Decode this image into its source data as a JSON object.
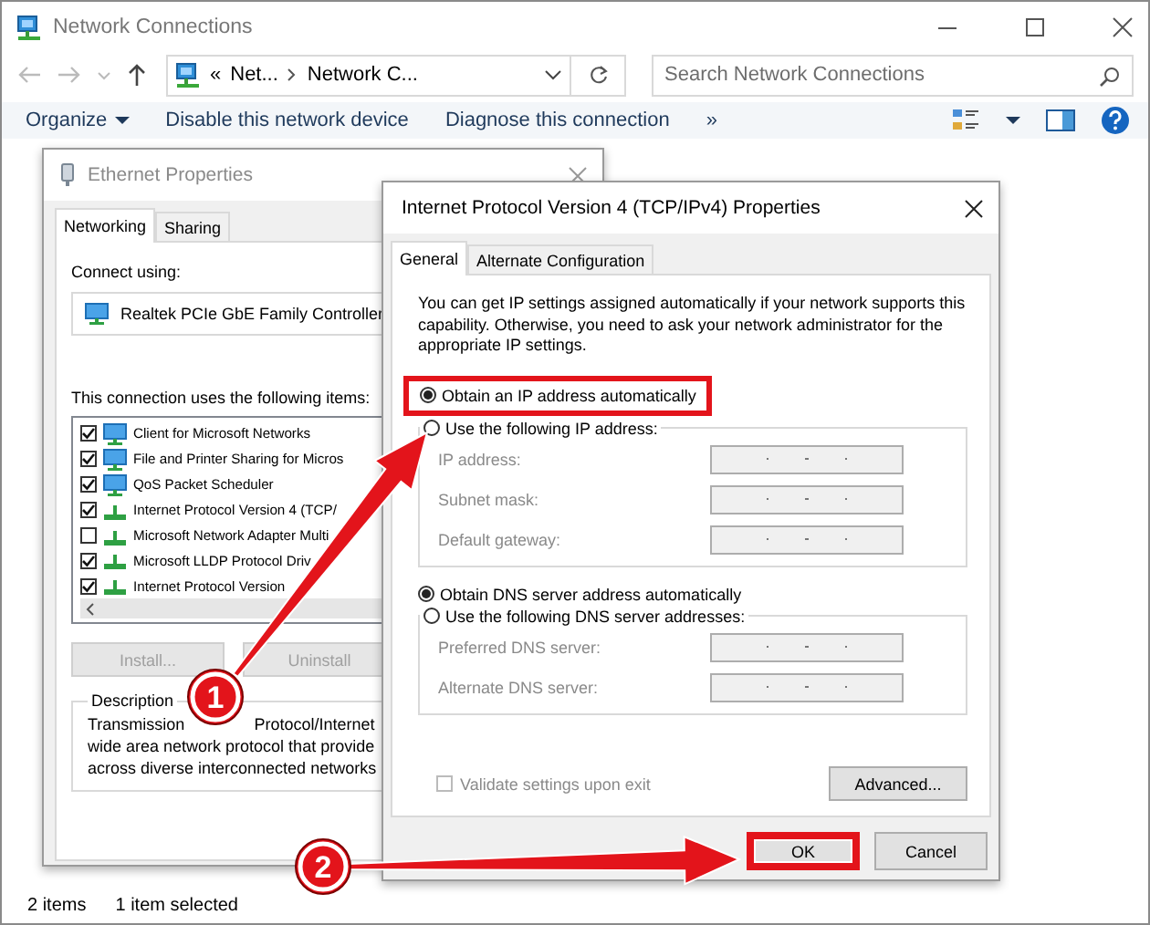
{
  "window": {
    "title": "Network Connections"
  },
  "address_bar": {
    "overflow": "«",
    "breadcrumbs": [
      "Net...",
      "Network C..."
    ]
  },
  "search": {
    "placeholder": "Search Network Connections"
  },
  "toolbar": {
    "items": [
      {
        "label": "Organize",
        "dropdown": true
      },
      {
        "label": "Disable this network device",
        "dropdown": false
      },
      {
        "label": "Diagnose this connection",
        "dropdown": false
      }
    ],
    "more": "»"
  },
  "ethernet_dialog": {
    "title": "Ethernet Properties",
    "tabs": [
      {
        "label": "Networking",
        "selected": true
      },
      {
        "label": "Sharing",
        "selected": false
      }
    ],
    "connect_using_label": "Connect using:",
    "adapter": "Realtek PCIe GbE Family Controller",
    "items_label": "This connection uses the following items:",
    "items": [
      {
        "label": "Client for Microsoft Networks",
        "checked": true,
        "kind": "client"
      },
      {
        "label": "File and Printer Sharing for Micros",
        "checked": true,
        "kind": "service"
      },
      {
        "label": "QoS Packet Scheduler",
        "checked": true,
        "kind": "service"
      },
      {
        "label": "Internet Protocol Version 4 (TCP/",
        "checked": true,
        "kind": "protocol"
      },
      {
        "label": "Microsoft Network Adapter Multi",
        "checked": false,
        "kind": "protocol"
      },
      {
        "label": "Microsoft LLDP Protocol Driv",
        "checked": true,
        "kind": "protocol"
      },
      {
        "label": "Internet Protocol Version",
        "checked": true,
        "kind": "protocol"
      }
    ],
    "buttons": [
      {
        "label": "Install...",
        "disabled": true
      },
      {
        "label": "Uninstall",
        "disabled": true
      }
    ],
    "description": {
      "title": "Description",
      "lines": [
        {
          "parts": [
            "Transmission",
            "Protocol/Internet"
          ]
        },
        {
          "parts": [
            "wide area network protocol that provide"
          ]
        },
        {
          "parts": [
            "across diverse interconnected networks"
          ]
        }
      ]
    }
  },
  "ipv4_dialog": {
    "title": "Internet Protocol Version 4 (TCP/IPv4) Properties",
    "tabs": [
      {
        "label": "General",
        "selected": true
      },
      {
        "label": "Alternate Configuration",
        "selected": false
      }
    ],
    "intro": "You can get IP settings assigned automatically if your network supports this capability. Otherwise, you need to ask your network administrator for the appropriate IP settings.",
    "ip_mode": [
      {
        "label": "Obtain an IP address automatically",
        "selected": true,
        "highlighted": true
      },
      {
        "label": "Use the following IP address:",
        "selected": false,
        "highlighted": false
      }
    ],
    "ip_fields": [
      {
        "label": "IP address:",
        "disabled": true
      },
      {
        "label": "Subnet mask:",
        "disabled": true
      },
      {
        "label": "Default gateway:",
        "disabled": true
      }
    ],
    "dns_mode": [
      {
        "label": "Obtain DNS server address automatically",
        "selected": true,
        "highlighted": false
      },
      {
        "label": "Use the following DNS server addresses:",
        "selected": false,
        "highlighted": false
      }
    ],
    "dns_fields": [
      {
        "label": "Preferred DNS server:",
        "disabled": true
      },
      {
        "label": "Alternate DNS server:",
        "disabled": true
      }
    ],
    "validate": {
      "label": "Validate settings upon exit",
      "checked": false,
      "disabled": true
    },
    "advanced_button": "Advanced...",
    "buttons": [
      {
        "label": "OK",
        "highlighted": true
      },
      {
        "label": "Cancel",
        "highlighted": false
      }
    ]
  },
  "callouts": [
    {
      "number": "1"
    },
    {
      "number": "2"
    }
  ],
  "status_bar": [
    "2 items",
    "1 item selected"
  ]
}
